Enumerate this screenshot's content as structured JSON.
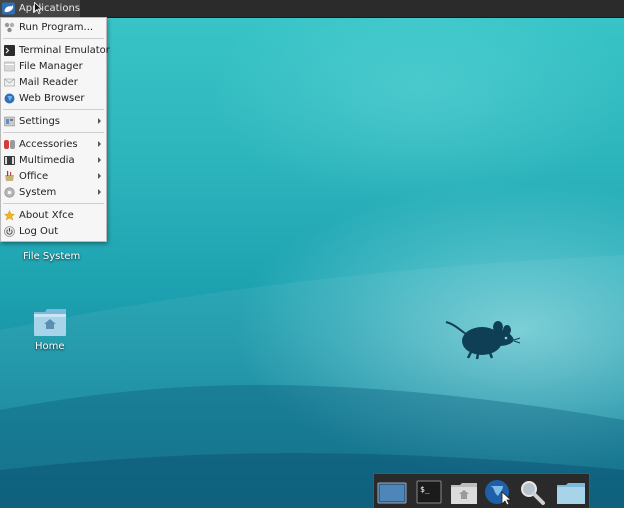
{
  "panel": {
    "applications_label": "Applications"
  },
  "menu": {
    "items": [
      {
        "label": "Run Program...",
        "icon": "run-program-icon",
        "submenu": false
      },
      {
        "label": "Terminal Emulator",
        "icon": "terminal-icon",
        "submenu": false
      },
      {
        "label": "File Manager",
        "icon": "file-manager-icon",
        "submenu": false
      },
      {
        "label": "Mail Reader",
        "icon": "mail-icon",
        "submenu": false
      },
      {
        "label": "Web Browser",
        "icon": "web-browser-icon",
        "submenu": false
      },
      {
        "label": "Settings",
        "icon": "settings-icon",
        "submenu": true
      },
      {
        "label": "Accessories",
        "icon": "accessories-icon",
        "submenu": true
      },
      {
        "label": "Multimedia",
        "icon": "multimedia-icon",
        "submenu": true
      },
      {
        "label": "Office",
        "icon": "office-icon",
        "submenu": true
      },
      {
        "label": "System",
        "icon": "system-icon",
        "submenu": true
      },
      {
        "label": "About Xfce",
        "icon": "star-icon",
        "submenu": false
      },
      {
        "label": "Log Out",
        "icon": "power-icon",
        "submenu": false
      }
    ]
  },
  "desktop": {
    "file_system_label": "File System",
    "home_label": "Home"
  },
  "dock": {
    "items": [
      "show-desktop-icon",
      "terminal-icon",
      "home-folder-icon",
      "web-browser-icon",
      "search-icon",
      "folder-icon"
    ]
  },
  "colors": {
    "panel_bg": "#2b2b2b",
    "menu_bg": "#f6f6f6",
    "desktop_top": "#39c6c8",
    "desktop_bottom": "#0e7690",
    "mouse_logo": "#0f3f55"
  }
}
